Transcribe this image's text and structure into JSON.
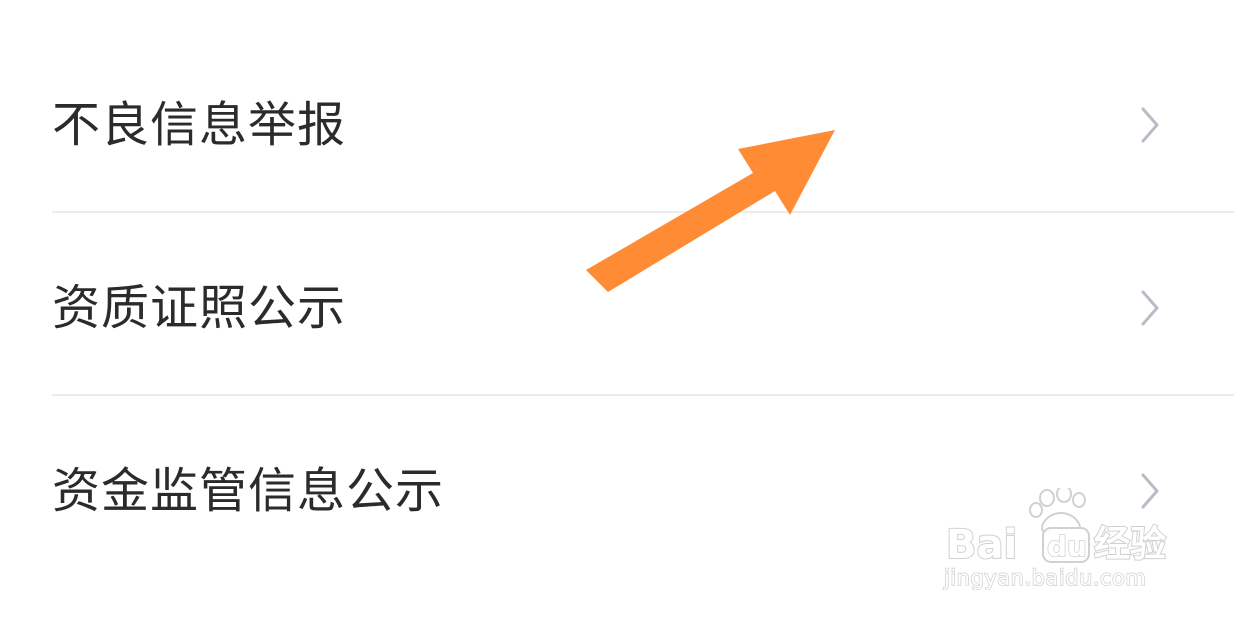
{
  "menu": {
    "items": [
      {
        "label": "不良信息举报"
      },
      {
        "label": "资质证照公示"
      },
      {
        "label": "资金监管信息公示"
      }
    ]
  },
  "annotation": {
    "arrow_color": "#FF8C35"
  },
  "watermark": {
    "brand": "Bai",
    "brand_suffix": "du",
    "product": "经验",
    "url": "jingyan.baidu.com"
  },
  "colors": {
    "text": "#2b2b2b",
    "divider": "#ececec",
    "chevron": "#b8bcc6"
  }
}
